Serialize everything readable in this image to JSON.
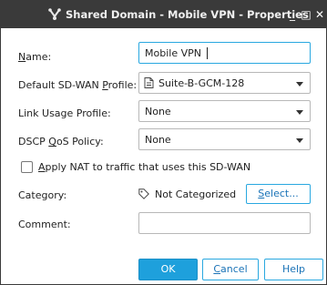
{
  "window": {
    "title": "Shared Domain - Mobile VPN - Properties",
    "buttons": {
      "minimize": "_",
      "maximize": "□",
      "close": "✕"
    }
  },
  "form": {
    "name": {
      "label_u": "N",
      "label_rest": "ame:",
      "value": "Mobile VPN"
    },
    "sdwan_profile": {
      "label_pre": "Default SD-WAN ",
      "label_u": "P",
      "label_rest": "rofile:",
      "value": "Suite-B-GCM-128",
      "icon": "profile-icon"
    },
    "link_usage": {
      "label": "Link Usage Profile:",
      "value": "None"
    },
    "dscp": {
      "label_pre": "DSCP ",
      "label_u": "Q",
      "label_rest": "oS Policy:",
      "value": "None"
    },
    "apply_nat": {
      "label_u": "A",
      "label_rest": "pply NAT to traffic that uses this SD-WAN",
      "checked": false
    },
    "category": {
      "label": "Category:",
      "value": "Not Categorized",
      "icon": "tag-icon",
      "select_label_u": "S",
      "select_label_rest": "elect..."
    },
    "comment": {
      "label": "Comment:",
      "value": ""
    }
  },
  "footer": {
    "ok": "OK",
    "cancel_u": "C",
    "cancel_rest": "ancel",
    "help": "Help"
  },
  "colors": {
    "titlebar": "#3a3a3a",
    "accent": "#1ea0dc",
    "link": "#1a73b7"
  }
}
